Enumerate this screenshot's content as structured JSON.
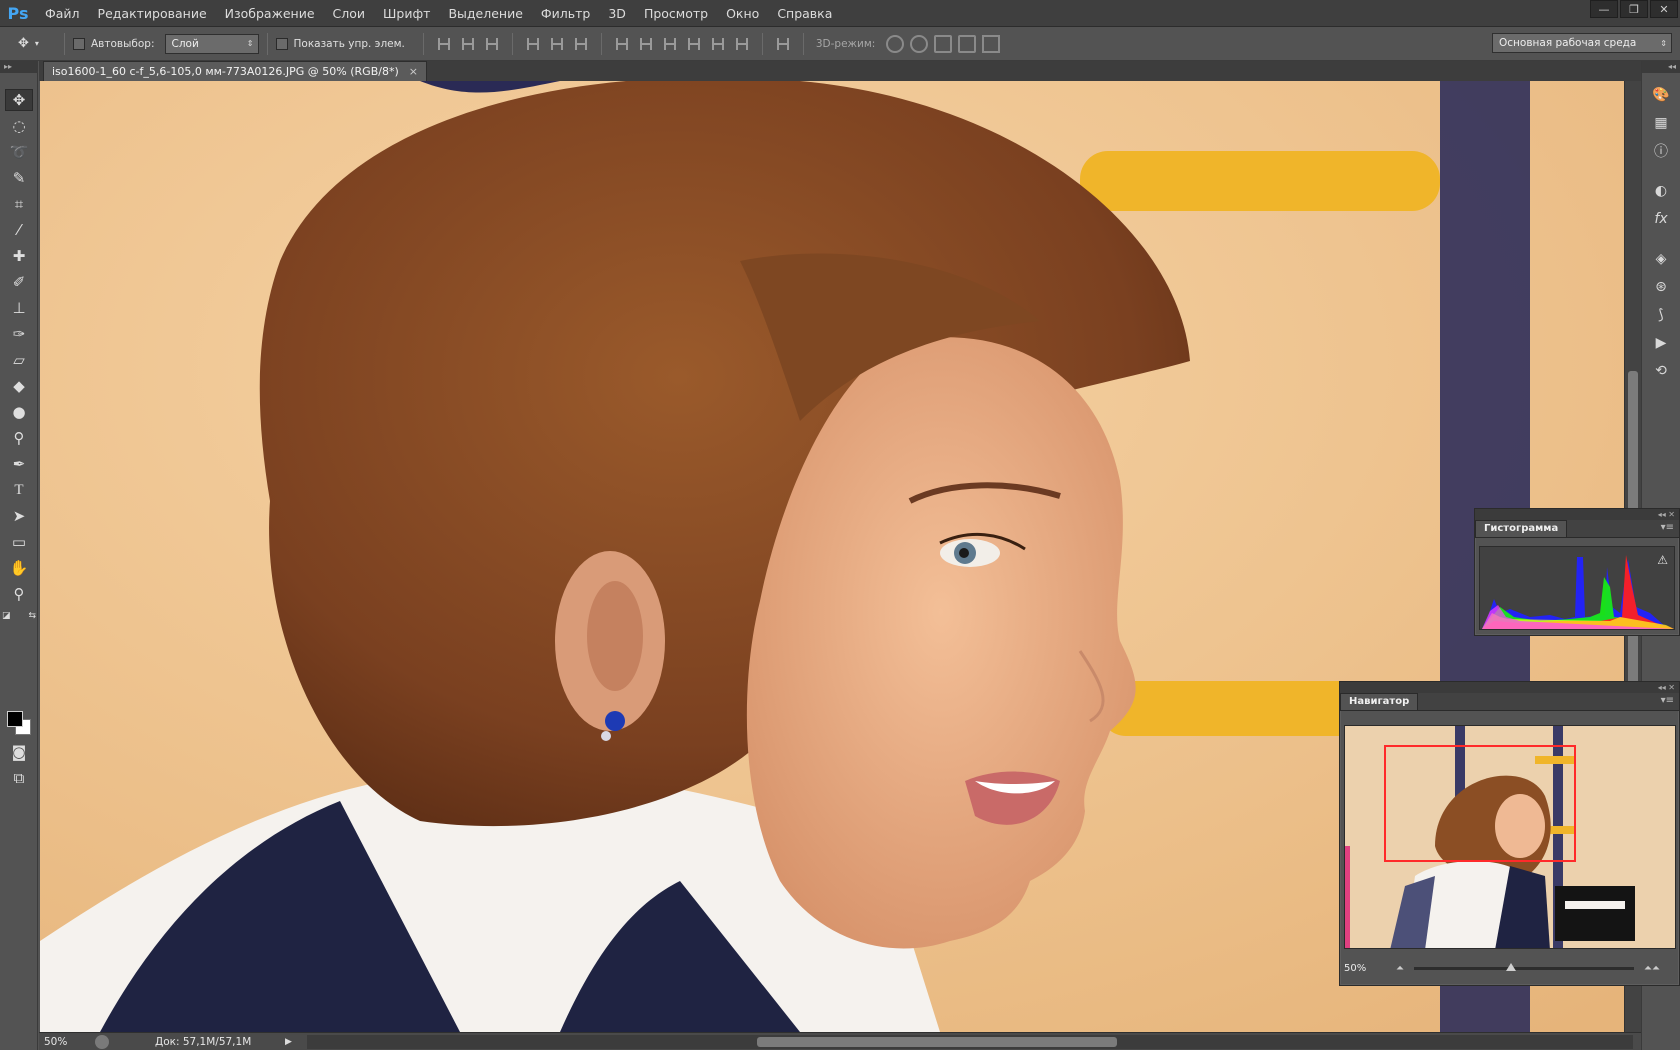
{
  "app": {
    "logo": "Ps"
  },
  "menu": [
    "Файл",
    "Редактирование",
    "Изображение",
    "Слои",
    "Шрифт",
    "Выделение",
    "Фильтр",
    "3D",
    "Просмотр",
    "Окно",
    "Справка"
  ],
  "window_controls": {
    "minimize": "—",
    "restore": "❐",
    "close": "✕"
  },
  "options": {
    "autoselect_label": "Автовыбор:",
    "autoselect_value": "Слой",
    "show_controls_label": "Показать упр. элем.",
    "mode_3d_label": "3D-режим:",
    "workspace": "Основная рабочая среда"
  },
  "document": {
    "tab_title": "iso1600-1_60 c-f_5,6-105,0 мм-773A0126.JPG @ 50% (RGB/8*)",
    "close_glyph": "×"
  },
  "status": {
    "zoom": "50%",
    "doc_info": "Док: 57,1M/57,1M"
  },
  "histogram": {
    "tab": "Гистограмма",
    "warning_icon": "warning-icon"
  },
  "navigator": {
    "tab": "Навигатор",
    "zoom": "50%"
  },
  "colors": {
    "accent_logo": "#44a6f3",
    "navigator_box": "#ff2a2a",
    "foreground": "#000000",
    "background": "#ffffff"
  },
  "icons": {
    "tools": [
      "move-tool-icon",
      "marquee-tool-icon",
      "lasso-tool-icon",
      "quick-select-tool-icon",
      "crop-tool-icon",
      "eyedropper-tool-icon",
      "healing-brush-icon",
      "brush-tool-icon",
      "clone-stamp-icon",
      "history-brush-icon",
      "eraser-tool-icon",
      "paint-bucket-icon",
      "blur-tool-icon",
      "dodge-tool-icon",
      "pen-tool-icon",
      "type-tool-icon",
      "path-select-icon",
      "rectangle-tool-icon",
      "hand-tool-icon",
      "zoom-tool-icon",
      "quick-mask-icon",
      "screen-mode-icon"
    ],
    "dock": [
      "color-panel-icon",
      "swatches-panel-icon",
      "info-panel-icon",
      "adjustments-panel-icon",
      "styles-panel-icon",
      "layers-panel-icon",
      "channels-panel-icon",
      "paths-panel-icon",
      "actions-panel-icon",
      "history-panel-icon"
    ]
  }
}
